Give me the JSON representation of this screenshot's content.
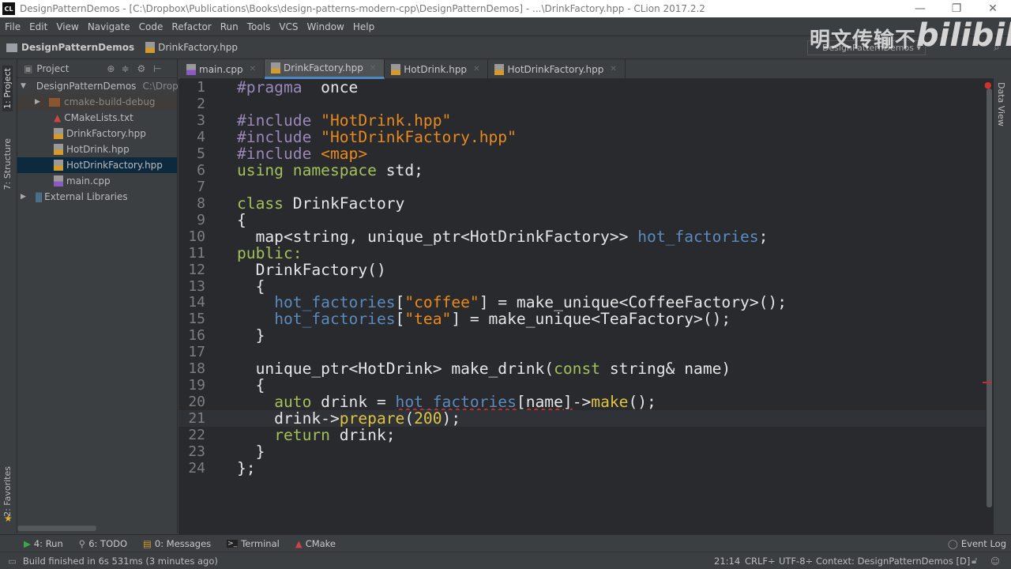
{
  "window": {
    "title": "DesignPatternDemos - [C:\\Dropbox\\Publications\\Books\\design-patterns-modern-cpp\\DesignPatternDemos] - ...\\DrinkFactory.hpp - CLion 2017.2.2",
    "logo": "CL"
  },
  "menu": [
    "File",
    "Edit",
    "View",
    "Navigate",
    "Code",
    "Refactor",
    "Run",
    "Tools",
    "VCS",
    "Window",
    "Help"
  ],
  "breadcrumb": {
    "project": "DesignPatternDemos",
    "file": "DrinkFactory.hpp"
  },
  "run_config": "DesignPatternDemos",
  "watermark": {
    "text": "明文传输不",
    "logo": "bilibili"
  },
  "left_strip": {
    "project": "1: Project",
    "structure": "7: Structure",
    "favorites": "2: Favorites"
  },
  "right_strip": {
    "data_view": "Data View"
  },
  "project_panel": {
    "title": "Project",
    "root": {
      "name": "DesignPatternDemos",
      "path": "C:\\Drop"
    },
    "items": [
      {
        "name": "cmake-build-debug",
        "type": "folder"
      },
      {
        "name": "CMakeLists.txt",
        "type": "cmake"
      },
      {
        "name": "DrinkFactory.hpp",
        "type": "header"
      },
      {
        "name": "HotDrink.hpp",
        "type": "header"
      },
      {
        "name": "HotDrinkFactory.hpp",
        "type": "header",
        "selected": true
      },
      {
        "name": "main.cpp",
        "type": "cpp"
      }
    ],
    "external": "External Libraries"
  },
  "tabs": [
    {
      "label": "main.cpp",
      "type": "cpp"
    },
    {
      "label": "DrinkFactory.hpp",
      "type": "header",
      "active": true
    },
    {
      "label": "HotDrink.hpp",
      "type": "header"
    },
    {
      "label": "HotDrinkFactory.hpp",
      "type": "header"
    }
  ],
  "colors": {
    "preprocessor": "#9c87b9",
    "string": "#e88a1e",
    "keyword": "#a3c05a",
    "field": "#5b8bbd",
    "function": "#e0c440",
    "text": "#e6e6e6",
    "background": "#282a2e"
  },
  "editor": {
    "current_line": 21,
    "lines": [
      [
        [
          "pp",
          "#pragma"
        ],
        [
          "",
          "  once"
        ]
      ],
      [],
      [
        [
          "pp",
          "#include"
        ],
        [
          "",
          " "
        ],
        [
          "str",
          "\"HotDrink.hpp\""
        ]
      ],
      [
        [
          "pp",
          "#include"
        ],
        [
          "",
          " "
        ],
        [
          "str",
          "\"HotDrinkFactory.hpp\""
        ]
      ],
      [
        [
          "pp",
          "#include"
        ],
        [
          "",
          " "
        ],
        [
          "str",
          "<map>"
        ]
      ],
      [
        [
          "kw",
          "using"
        ],
        [
          "",
          " "
        ],
        [
          "kw",
          "namespace"
        ],
        [
          "",
          " std;"
        ]
      ],
      [],
      [
        [
          "kw",
          "class"
        ],
        [
          "",
          " DrinkFactory"
        ]
      ],
      [
        [
          "",
          "{"
        ]
      ],
      [
        [
          "",
          "  map<string, unique_ptr<HotDrinkFactory>> "
        ],
        [
          "field",
          "hot_factories"
        ],
        [
          "",
          ";"
        ]
      ],
      [
        [
          "kw",
          "public:"
        ]
      ],
      [
        [
          "",
          "  DrinkFactory()"
        ]
      ],
      [
        [
          "",
          "  {"
        ]
      ],
      [
        [
          "",
          "    "
        ],
        [
          "field",
          "hot_factories"
        ],
        [
          "",
          "["
        ],
        [
          "str",
          "\"coffee\""
        ],
        [
          "",
          "] = make_unique<CoffeeFactory>();"
        ]
      ],
      [
        [
          "",
          "    "
        ],
        [
          "field",
          "hot_factories"
        ],
        [
          "",
          "["
        ],
        [
          "str",
          "\"tea\""
        ],
        [
          "",
          "] = make_unique<TeaFactory>();"
        ]
      ],
      [
        [
          "",
          "  }"
        ]
      ],
      [],
      [
        [
          "",
          "  unique_ptr<HotDrink> make_drink("
        ],
        [
          "kw",
          "const"
        ],
        [
          "",
          " string& name)"
        ]
      ],
      [
        [
          "",
          "  {"
        ]
      ],
      [
        [
          "",
          "    "
        ],
        [
          "kw",
          "auto"
        ],
        [
          "",
          " drink = "
        ],
        [
          "field err",
          "hot_factories"
        ],
        [
          "err",
          "[name]"
        ],
        [
          "",
          "->"
        ],
        [
          "fn",
          "make"
        ],
        [
          "",
          "();"
        ]
      ],
      [
        [
          "",
          "    drink->"
        ],
        [
          "fn",
          "prepare"
        ],
        [
          "",
          "("
        ],
        [
          "num",
          "200"
        ],
        [
          "",
          ");"
        ]
      ],
      [
        [
          "",
          "    "
        ],
        [
          "kw",
          "return"
        ],
        [
          "",
          " drink;"
        ]
      ],
      [
        [
          "",
          "  }"
        ]
      ],
      [
        [
          "",
          "};"
        ]
      ]
    ]
  },
  "tool_windows": [
    {
      "label": "4: Run",
      "icon": "run-icon"
    },
    {
      "label": "6: TODO",
      "icon": "todo-icon"
    },
    {
      "label": "0: Messages",
      "icon": "messages-icon"
    },
    {
      "label": "Terminal",
      "icon": "terminal-icon"
    },
    {
      "label": "CMake",
      "icon": "cmake-icon"
    }
  ],
  "event_log": "Event Log",
  "status": {
    "message": "Build finished in 6s 531ms (3 minutes ago)",
    "position": "21:14",
    "line_sep": "CRLF÷",
    "encoding": "UTF-8÷",
    "context": "Context: DesignPatternDemos [D]"
  }
}
